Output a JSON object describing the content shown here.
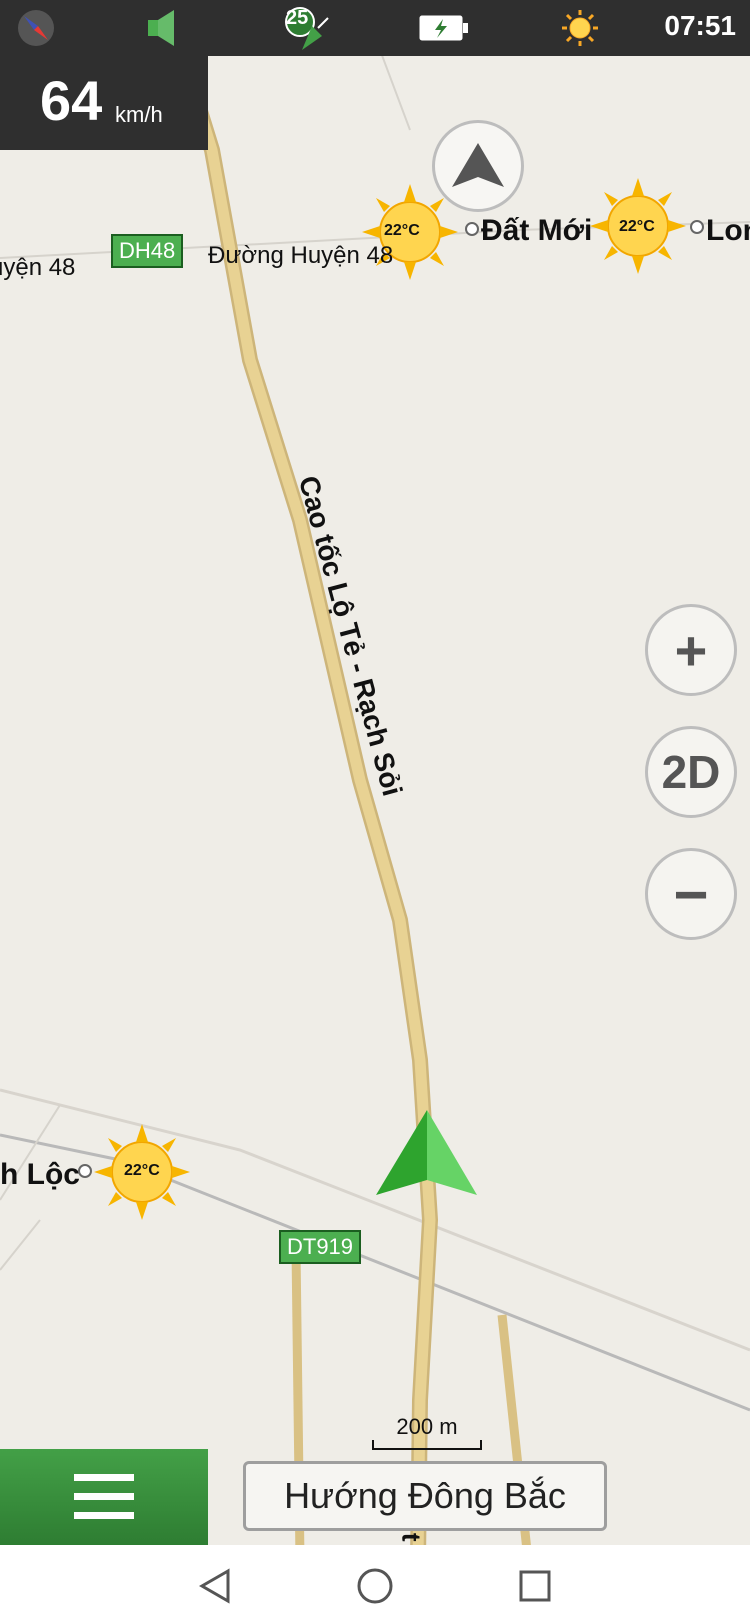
{
  "status_bar": {
    "time": "07:51",
    "satellite_count": "25",
    "icons": [
      "compass-icon",
      "speaker-icon",
      "gps-satellite-icon",
      "battery-charging-icon",
      "sun-icon"
    ]
  },
  "speed": {
    "value": "64",
    "unit": "km/h"
  },
  "map": {
    "road_name": "Cao tốc Lộ Tẻ - Rạch Sỏi",
    "road_fragment": "Qo t",
    "road_top": "Đường Huyện 48",
    "road_top_left": "uyện 48",
    "shield_dh48": "DH48",
    "shield_dt919": "DT919",
    "place_dat_moi": "Đất Mới",
    "place_lon": "Lon",
    "place_loc": "h Lộc",
    "weather_temp": "22°C"
  },
  "controls": {
    "zoom_in": "+",
    "view_mode": "2D",
    "zoom_out": "−"
  },
  "scale_bar": "200 m",
  "direction": "Hướng Đông Bắc",
  "colors": {
    "map_bg": "#efede7",
    "road": "#e3c98a",
    "nav_arrow": "#3cbf3c",
    "shield": "#4caf50"
  }
}
